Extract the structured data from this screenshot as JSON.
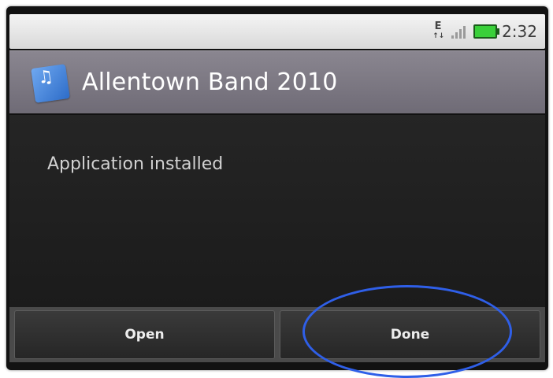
{
  "status_bar": {
    "network_label": "E",
    "network_arrows": "↑↓",
    "time": "2:32",
    "battery_color": "#39d039"
  },
  "title_bar": {
    "app_name": "Allentown Band 2010",
    "icon_name": "app-icon"
  },
  "content": {
    "message": "Application installed"
  },
  "buttons": {
    "open_label": "Open",
    "done_label": "Done"
  },
  "annotation": {
    "highlight_target": "done-button",
    "color": "#2f5fe8"
  }
}
